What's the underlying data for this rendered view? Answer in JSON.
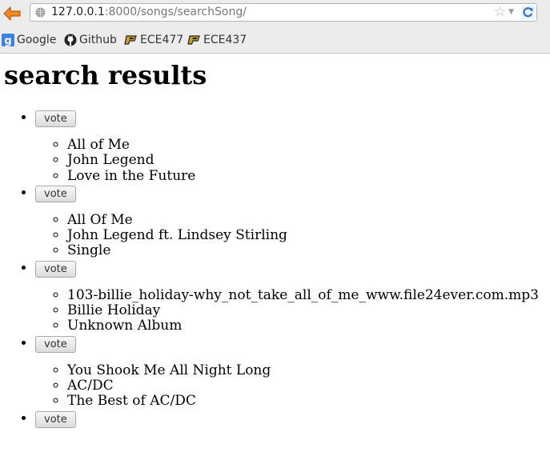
{
  "browser": {
    "url_host": "127.0.0.1",
    "url_path": ":8000/songs/searchSong/",
    "star_icon": "star-icon",
    "bookmarks": [
      {
        "label": "Google",
        "icon": "google-icon"
      },
      {
        "label": "Github",
        "icon": "github-icon"
      },
      {
        "label": "ECE477",
        "icon": "purdue-icon"
      },
      {
        "label": "ECE437",
        "icon": "purdue-icon"
      }
    ]
  },
  "page": {
    "title": "search results",
    "vote_label": "vote",
    "results": [
      {
        "title": "All of Me",
        "artist": "John Legend",
        "album": "Love in the Future"
      },
      {
        "title": "All Of Me",
        "artist": "John Legend ft. Lindsey Stirling",
        "album": "Single"
      },
      {
        "title": "103-billie_holiday-why_not_take_all_of_me_www.file24ever.com.mp3",
        "artist": "Billie Holiday",
        "album": "Unknown Album"
      },
      {
        "title": "You Shook Me All Night Long",
        "artist": "AC/DC",
        "album": "The Best of AC/DC"
      }
    ]
  },
  "colors": {
    "toolbar_bg": "#ececec",
    "back_arrow": "#e8711a",
    "reload": "#3d7fc9"
  }
}
